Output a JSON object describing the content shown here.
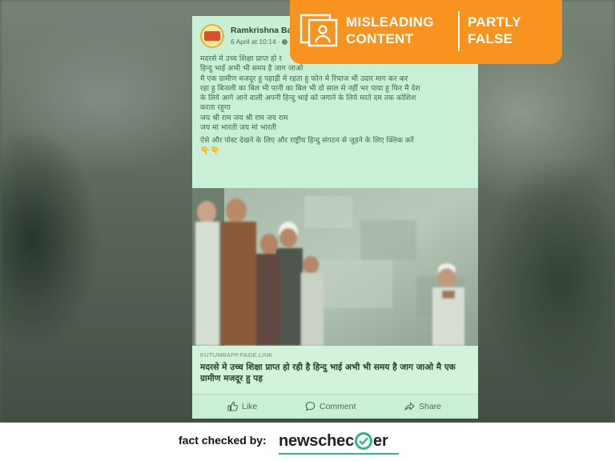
{
  "post": {
    "author": "Ramkrishna Baro",
    "time": "6 April at 10:14 ·",
    "lines": [
      "मदरसे मे उच्च शिक्षा प्राप्त हो र",
      "हिन्दु भाई अभी भी समय है जाग जाओ",
      "मै एक ग्रामीण मजदूर हु पहाड़ी मे रहता हु फोन मे रिचाज भी उदार माग कर कर",
      "रहा हु बिजली का बिल भी पानी का बिल भी दो साल से नहीं भर पाया हु फिर मै देश",
      "के लिये आगे आने वाली अपनी हिन्दु भाई को जगाने के लिये मरते दम तक कोशिश",
      "करता रहूगा",
      "जय श्री राम जय श्री राम जय राम",
      "जय मां भारती जय मां भारती"
    ],
    "cta": "ऐसे और पोस्ट देखने के लिए और राष्ट्रीय हिन्दु संगठन से जुड़ने के लिए क्लिक करें",
    "cta_emoji": "👇👇",
    "link_domain": "KUTUMBAPP.PAGE.LINK",
    "link_title": "मदरसे मे उच्च शिक्षा प्राप्त हो रही है हिन्दु भाई अभी भी समय है जाग जाओ मै एक ग्रामीण मजदूर हु पह",
    "actions": {
      "like": "Like",
      "comment": "Comment",
      "share": "Share"
    }
  },
  "badge": {
    "left_line1": "MISLEADING",
    "left_line2": "CONTENT",
    "right_line1": "PARTLY",
    "right_line2": "FALSE"
  },
  "footer": {
    "label": "fact checked by:",
    "brand_pre": "newschec",
    "brand_post": "er"
  },
  "colors": {
    "badge": "#f7931e",
    "card_bg": "#c9efd6",
    "brand_green": "#2eb88a"
  }
}
